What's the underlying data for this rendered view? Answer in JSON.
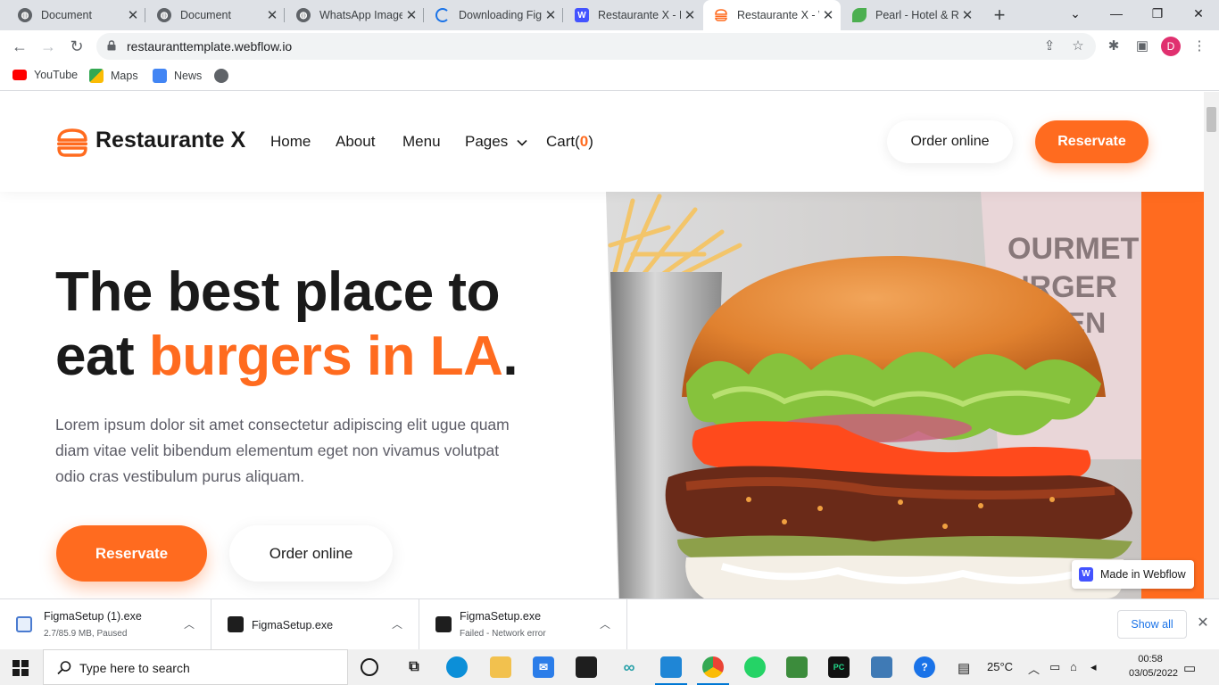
{
  "browser": {
    "tabs": [
      {
        "title": "Document",
        "favicon": "globe-icon",
        "color": "#5f6368"
      },
      {
        "title": "Document",
        "favicon": "globe-icon",
        "color": "#5f6368"
      },
      {
        "title": "WhatsApp Image",
        "favicon": "globe-icon",
        "color": "#5f6368"
      },
      {
        "title": "Downloading Fig",
        "favicon": "loading-icon",
        "color": "#1a73e8"
      },
      {
        "title": "Restaurante X - R",
        "favicon": "webflow-icon",
        "color": "#4353ff"
      },
      {
        "title": "Restaurante X - W",
        "favicon": "burger-icon",
        "color": "#ff6b1f"
      },
      {
        "title": "Pearl - Hotel & R",
        "favicon": "leaf-icon",
        "color": "#4caf50"
      }
    ],
    "url": "restauranttemplate.webflow.io",
    "profile_initial": "D",
    "bookmarks": [
      {
        "label": "YouTube",
        "icon": "youtube-icon",
        "color": "#ff0000"
      },
      {
        "label": "Maps",
        "icon": "maps-icon",
        "color": "#34a853"
      },
      {
        "label": "News",
        "icon": "news-icon",
        "color": "#4285f4"
      },
      {
        "label": "",
        "icon": "globe-icon",
        "color": "#5f6368"
      }
    ]
  },
  "site": {
    "brand": "Restaurante X",
    "nav": {
      "home": "Home",
      "about": "About",
      "menu": "Menu",
      "pages": "Pages",
      "cart_label": "Cart(",
      "cart_count": "0",
      "cart_close": ")"
    },
    "order_online": "Order online",
    "reservate": "Reservate",
    "hero": {
      "title_line1": "The best place to",
      "title_line2_start": "eat ",
      "title_accent": "burgers in LA",
      "title_end": ".",
      "body": "Lorem ipsum dolor sit amet consectetur adipiscing elit ugue quam diam vitae velit bibendum elementum eget non vivamus volutpat odio cras vestibulum purus aliquam.",
      "primary_button": "Reservate",
      "secondary_button": "Order online"
    },
    "badge": "Made in Webflow",
    "accent_color": "#ff6b1f"
  },
  "downloads": {
    "items": [
      {
        "name": "FigmaSetup (1).exe",
        "status": "2.7/85.9 MB, Paused"
      },
      {
        "name": "FigmaSetup.exe",
        "status": ""
      },
      {
        "name": "FigmaSetup.exe",
        "status": "Failed - Network error"
      }
    ],
    "show_all": "Show all"
  },
  "taskbar": {
    "search_placeholder": "Type here to search",
    "temperature": "25°C",
    "time": "00:58",
    "date": "03/05/2022"
  }
}
